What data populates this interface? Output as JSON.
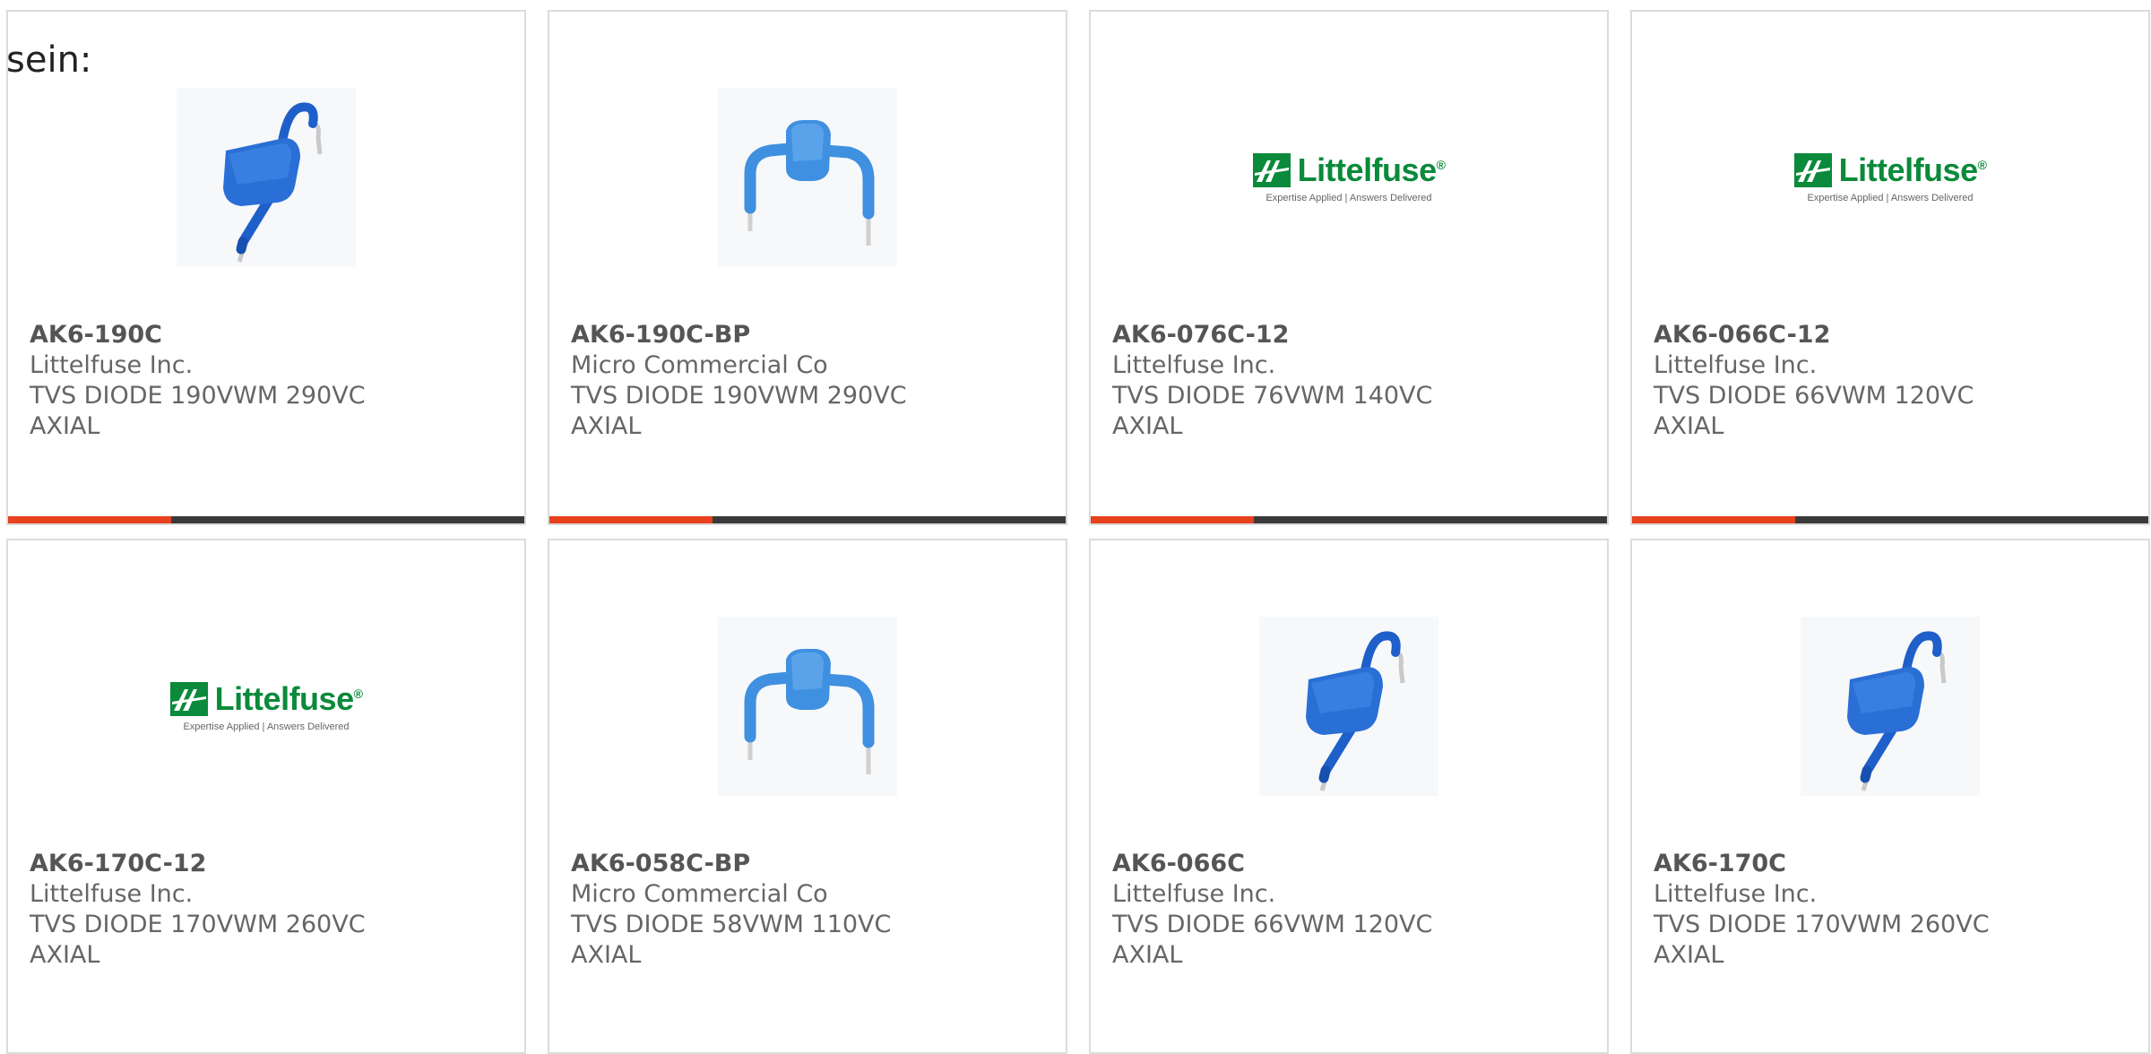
{
  "intro_text": "sein:",
  "accent_color": "#e8411e",
  "bar_color": "#3a3a3a",
  "logo": {
    "name": "Littelfuse",
    "registered": "®",
    "tagline": "Expertise Applied | Answers Delivered",
    "color": "#0a8a3a"
  },
  "products": [
    {
      "part": "AK6-190C",
      "manufacturer": "Littelfuse Inc.",
      "description": "TVS DIODE 190VWM 290VC AXIAL",
      "image": "diode-bent-leads-photo"
    },
    {
      "part": "AK6-190C-BP",
      "manufacturer": "Micro Commercial Co",
      "description": "TVS DIODE 190VWM 290VC AXIAL",
      "image": "diode-u-shape-photo"
    },
    {
      "part": "AK6-076C-12",
      "manufacturer": "Littelfuse Inc.",
      "description": "TVS DIODE 76VWM 140VC AXIAL",
      "image": "littelfuse-logo"
    },
    {
      "part": "AK6-066C-12",
      "manufacturer": "Littelfuse Inc.",
      "description": "TVS DIODE 66VWM 120VC AXIAL",
      "image": "littelfuse-logo"
    },
    {
      "part": "AK6-170C-12",
      "manufacturer": "Littelfuse Inc.",
      "description": "TVS DIODE 170VWM 260VC AXIAL",
      "image": "littelfuse-logo"
    },
    {
      "part": "AK6-058C-BP",
      "manufacturer": "Micro Commercial Co",
      "description": "TVS DIODE 58VWM 110VC AXIAL",
      "image": "diode-u-shape-photo"
    },
    {
      "part": "AK6-066C",
      "manufacturer": "Littelfuse Inc.",
      "description": "TVS DIODE 66VWM 120VC AXIAL",
      "image": "diode-bent-leads-photo"
    },
    {
      "part": "AK6-170C",
      "manufacturer": "Littelfuse Inc.",
      "description": "TVS DIODE 170VWM 260VC AXIAL",
      "image": "diode-bent-leads-photo"
    }
  ]
}
